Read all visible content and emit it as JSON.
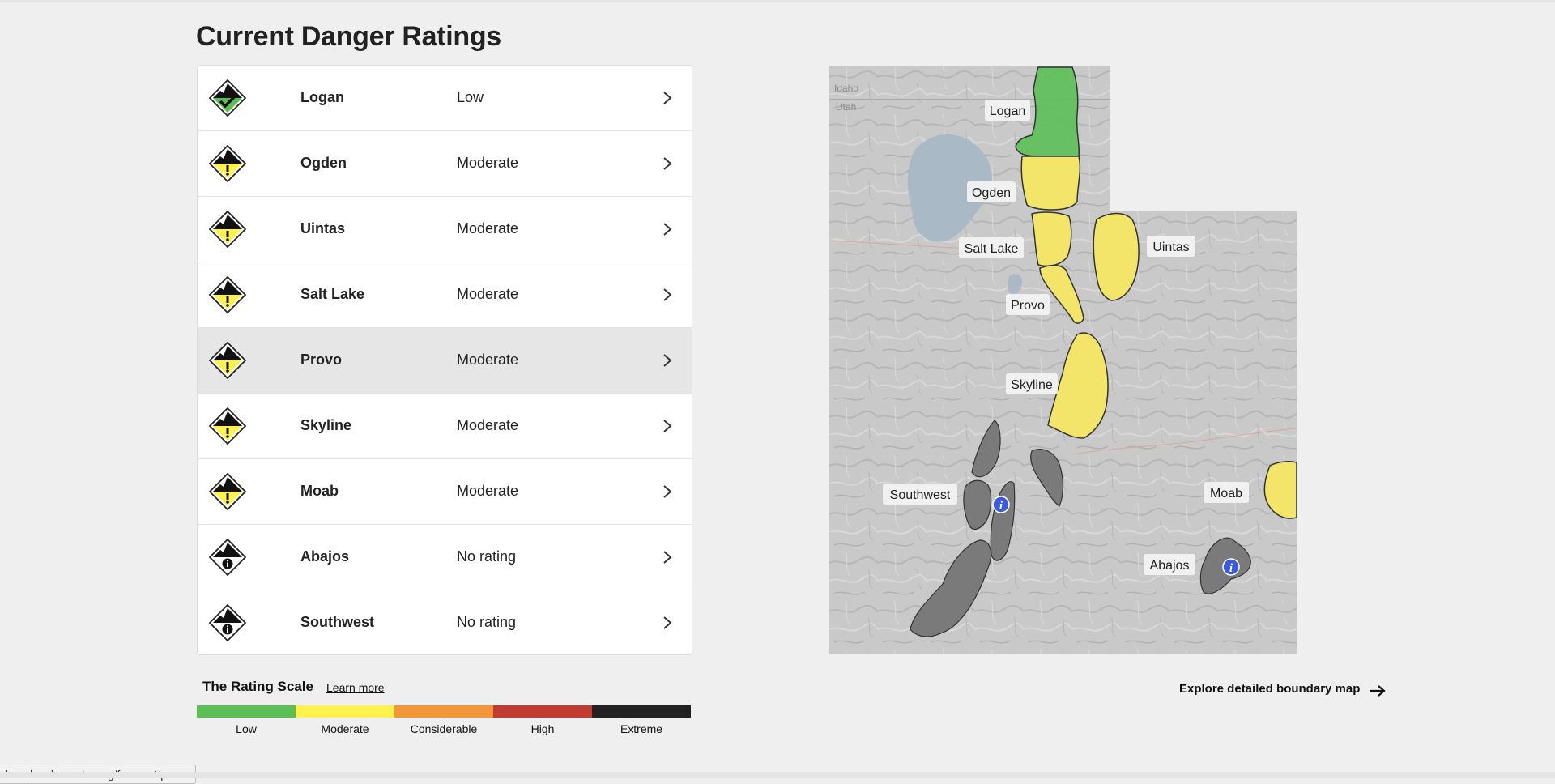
{
  "page": {
    "title": "Current Danger Ratings"
  },
  "colors": {
    "low": "#5cbf56",
    "moderate": "#fff24f",
    "considerable": "#f4963a",
    "high": "#c23b30",
    "extreme": "#222222",
    "no_rating": "#808080"
  },
  "regions": [
    {
      "name": "Logan",
      "rating": "Low",
      "icon": "danger-low-icon"
    },
    {
      "name": "Ogden",
      "rating": "Moderate",
      "icon": "danger-moderate-icon"
    },
    {
      "name": "Uintas",
      "rating": "Moderate",
      "icon": "danger-moderate-icon"
    },
    {
      "name": "Salt Lake",
      "rating": "Moderate",
      "icon": "danger-moderate-icon"
    },
    {
      "name": "Provo",
      "rating": "Moderate",
      "icon": "danger-moderate-icon",
      "highlighted": true
    },
    {
      "name": "Skyline",
      "rating": "Moderate",
      "icon": "danger-moderate-icon"
    },
    {
      "name": "Moab",
      "rating": "Moderate",
      "icon": "danger-moderate-icon"
    },
    {
      "name": "Abajos",
      "rating": "No rating",
      "icon": "danger-no-rating-icon"
    },
    {
      "name": "Southwest",
      "rating": "No rating",
      "icon": "danger-no-rating-icon"
    }
  ],
  "rating_scale": {
    "title": "The Rating Scale",
    "learn_more": "Learn more",
    "levels": [
      {
        "label": "Low",
        "color": "#5cbf56"
      },
      {
        "label": "Moderate",
        "color": "#fff24f"
      },
      {
        "label": "Considerable",
        "color": "#f4963a"
      },
      {
        "label": "High",
        "color": "#c23b30"
      },
      {
        "label": "Extreme",
        "color": "#222222"
      }
    ]
  },
  "map": {
    "state_labels": [
      "Idaho",
      "Utah"
    ],
    "region_labels": {
      "logan": "Logan",
      "ogden": "Ogden",
      "salt_lake": "Salt Lake",
      "uintas": "Uintas",
      "provo": "Provo",
      "skyline": "Skyline",
      "southwest": "Southwest",
      "moab": "Moab",
      "abajos": "Abajos"
    },
    "info_icon_glyph": "i"
  },
  "explore_link": "Explore detailed boundary map",
  "status_url": "ahavalanchecenter.org/forecast/provo"
}
